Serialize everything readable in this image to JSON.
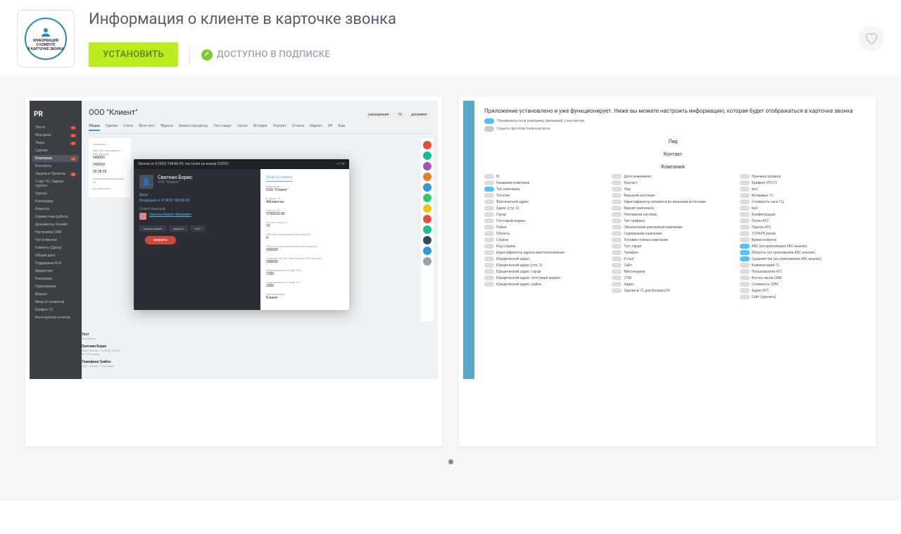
{
  "header": {
    "title": "Информация о клиенте в карточке звонка",
    "install_label": "УСТАНОВИТЬ",
    "subscription_label": "ДОСТУПНО В ПОДПИСКЕ",
    "icon_text_1": "ИНФОРМАЦИЯ",
    "icon_text_2": "О КЛИЕНТЕ",
    "icon_text_3": "В КАРТОЧКЕ ЗВОНКА"
  },
  "shot1": {
    "logo": "PR",
    "sidebar": [
      {
        "label": "Лента",
        "badge": "1"
      },
      {
        "label": "Мои дела",
        "badge": "2"
      },
      {
        "label": "Лиды",
        "badge": "3"
      },
      {
        "label": "Сделки",
        "badge": ""
      },
      {
        "label": "Компании",
        "badge": "4",
        "active": true
      },
      {
        "label": "Контакты",
        "badge": ""
      },
      {
        "label": "Задачи и Проекты",
        "badge": "5"
      },
      {
        "label": "Старт 1С: Задача группы",
        "badge": ""
      },
      {
        "label": "Группы",
        "badge": ""
      },
      {
        "label": "Календарь",
        "badge": ""
      },
      {
        "label": "Новости",
        "badge": ""
      },
      {
        "label": "Совместная работа",
        "badge": ""
      },
      {
        "label": "Документы Онлайн",
        "badge": ""
      },
      {
        "label": "Настройки CRM",
        "badge": ""
      },
      {
        "label": "Чат и звонки",
        "badge": ""
      },
      {
        "label": "Клиенты (Дела)",
        "badge": ""
      },
      {
        "label": "Общий диск",
        "badge": ""
      },
      {
        "label": "Поддержка Б24",
        "badge": ""
      },
      {
        "label": "Маркетинг",
        "badge": ""
      },
      {
        "label": "Компания",
        "badge": ""
      },
      {
        "label": "Приложения",
        "badge": ""
      },
      {
        "label": "Маркет",
        "badge": ""
      },
      {
        "label": "Ввод от клиентов",
        "badge": ""
      },
      {
        "label": "Боефон 1С",
        "badge": ""
      },
      {
        "label": "Конструктор отчетов",
        "badge": ""
      }
    ],
    "company_title": "ООО \"Клиент\"",
    "top_buttons": {
      "ext": "расширения",
      "1c": "1С",
      "doc": "документ"
    },
    "tabs": [
      "Общие",
      "Сделки",
      "Счета",
      "Фулл-тест",
      "Франчо",
      "Бизнес-процессы",
      "Тест смарт",
      "Склон",
      "История",
      "Портрет",
      "Отчеты",
      "Маркет",
      "HR",
      "Еще"
    ],
    "left_fields": [
      {
        "label": "компания",
        "value": ""
      },
      {
        "label": "ABC (из приложения ABC-анализ)",
        "value": "540000"
      },
      {
        "label": "",
        "value": "540000"
      },
      {
        "label": "",
        "value": "00:38:38"
      },
      {
        "label": "Минимальный вариант ит…",
        "value": ""
      },
      {
        "label": "не заполнено",
        "value": ""
      }
    ],
    "modal": {
      "head": "Звонок от 8 (903) 188-86-93, поступил на номер 222931",
      "person_name": "Святкин Борис",
      "person_sub": "ООО \"Клиент\"",
      "section_dela": "Дела",
      "dela_link": "Входящий от 8 (903) 188-86-93",
      "section_otv": "Ответственный",
      "otv_name": "Святкин Борис Иванович",
      "actions": [
        "комментарий",
        "удалить",
        "тест"
      ],
      "close": "закрыть",
      "info_title": "Инфо о клиенте",
      "info": [
        {
          "label": "Компания",
          "value": "ООО \"Клиент\""
        },
        {
          "label": "В цикле 1С",
          "value": "Абонентка"
        },
        {
          "label": "Оценка 1С",
          "value": "1950030.00"
        },
        {
          "label": "Кол-во часов 1С",
          "value": "10"
        },
        {
          "label": "ABC (из приложения ABC-анализ)",
          "value": "A"
        },
        {
          "label": "Обороты (из приложения ABC-анализ)",
          "value": "540000"
        },
        {
          "label": "Средний чек (из приложения ABC-анализ)",
          "value": "540000"
        },
        {
          "label": "Задолженность Проф. ИТС",
          "value": "1500"
        },
        {
          "label": "Задолженность Проф. ИТ",
          "value": "2000"
        },
        {
          "label": "Тип компании",
          "value": "Клиент"
        }
      ]
    },
    "persons": [
      {
        "name": "Тест",
        "sub": "остальное"
      },
      {
        "name": "Святкин Борис",
        "sub": "ООО \"Клиент\" · 8 (903) 188-86-93, Ext номер"
      },
      {
        "name": "Тимофеев Грабос",
        "sub": "ООО \"Клиент\"· Ext номер"
      }
    ],
    "rail_colors": [
      "#e74c3c",
      "#1abc9c",
      "#9b59b6",
      "#e67e22",
      "#3498db",
      "#2ecc71",
      "#f1c40f",
      "#e74c3c",
      "#1abc9c",
      "#34495e",
      "#3498db",
      "#95a5a6"
    ]
  },
  "shot2": {
    "intro": "Приложение установлено и уже функционирует. Ниже вы можете настроить информацию, которая будет отображаться в карточке звонка",
    "toggle1": "Показывать поля компании, связанной с контактом",
    "toggle2": "Скрыть при этом поля контакта",
    "sections": [
      "Лид",
      "Контакт",
      "Компания"
    ],
    "cols": [
      [
        "ID",
        "Название компании",
        "Тип компании",
        "Логотип",
        "Фактический адрес",
        "Адрес (стр. 2)",
        "Город",
        "Почтовый индекс",
        "Район",
        "Область",
        "Страна",
        "Код страны",
        "Идентификатор адреса местоположения",
        "Юридический адрес",
        "Юридический адрес (стр. 2)",
        "Юридический адрес: город",
        "Юридический адрес: почтовый индекс",
        "Юридический адрес: район"
      ],
      [
        "Дата изменения",
        "Контакт",
        "Лид",
        "Внешний источник",
        "Идентификатор элемента во внешнем источнике",
        "Версия оригинала",
        "Рекламная система",
        "Тип трафика",
        "Обозначение рекламной кампании",
        "Содержание кампании",
        "Условие поиска кампании",
        "Тест смарт",
        "Телефон",
        "E-mail",
        "Сайт",
        "Мессенджер",
        "UTM",
        "Адрес",
        "Удален в 1С для Битрикс24"
      ],
      [
        "Причина провала",
        "Брифинг ИТС/3",
        "test",
        "Интервью 1С",
        "Стоимость часа ТЦ",
        "test",
        "Конфигурация",
        "Логин АТС",
        "Пароль АТС",
        "1СПАРК риски",
        "Время клиента",
        "ABC (из приложения ABC-анализ)",
        "Обороты (из приложения ABC-анализ)",
        "Средний чек (из приложения ABC-анализ)",
        "Комментарий 1С",
        "Пользователи АТС",
        "Кол-во часов CRM",
        "Стоимость CRM",
        "Адрес АТС",
        "Сайт (удалить)"
      ]
    ],
    "col3_on": [
      11,
      12,
      13
    ]
  }
}
